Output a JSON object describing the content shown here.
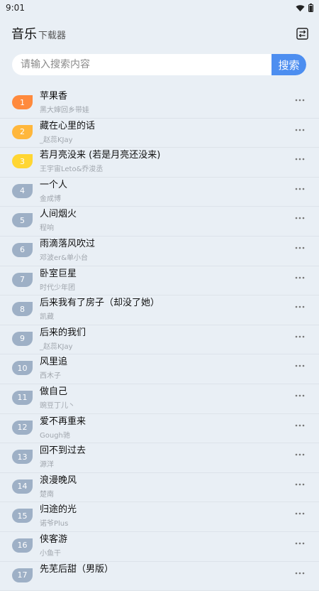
{
  "status_bar": {
    "time": "9:01"
  },
  "header": {
    "title": "音乐",
    "subtitle": "下载器"
  },
  "search": {
    "placeholder": "请输入搜索内容",
    "button_label": "搜索"
  },
  "colors": {
    "rank1": "#ff8a3d",
    "rank2": "#ffb73c",
    "rank3": "#ffd633",
    "rank_default": "#9eb0c6",
    "accent": "#4d8ef0"
  },
  "songs": [
    {
      "rank": "1",
      "title": "苹果香",
      "artist": "黑大婶回乡带娃"
    },
    {
      "rank": "2",
      "title": "藏在心里的话",
      "artist": "_赵蕊KJay"
    },
    {
      "rank": "3",
      "title": "若月亮没来 (若是月亮还没来)",
      "artist": "王宇宙Leto&乔浚丞"
    },
    {
      "rank": "4",
      "title": "一个人",
      "artist": "金成博"
    },
    {
      "rank": "5",
      "title": "人间烟火",
      "artist": "程响"
    },
    {
      "rank": "6",
      "title": "雨滴落风吹过",
      "artist": "邓波er&单小台"
    },
    {
      "rank": "7",
      "title": "卧室巨星",
      "artist": "时代少年团"
    },
    {
      "rank": "8",
      "title": "后来我有了房子（却没了她）",
      "artist": "凯藏"
    },
    {
      "rank": "9",
      "title": "后来的我们",
      "artist": "_赵蕊KJay"
    },
    {
      "rank": "10",
      "title": "风里追",
      "artist": "西木子"
    },
    {
      "rank": "11",
      "title": "做自己",
      "artist": "豌豆丁儿丶"
    },
    {
      "rank": "12",
      "title": "爱不再重来",
      "artist": "Gough驰"
    },
    {
      "rank": "13",
      "title": "回不到过去",
      "artist": "源洋"
    },
    {
      "rank": "14",
      "title": "浪漫晚风",
      "artist": "楚南"
    },
    {
      "rank": "15",
      "title": "归途的光",
      "artist": "诺爷Plus"
    },
    {
      "rank": "16",
      "title": "侠客游",
      "artist": "小鱼干"
    },
    {
      "rank": "17",
      "title": "先芜后甜（男版）",
      "artist": ""
    }
  ]
}
